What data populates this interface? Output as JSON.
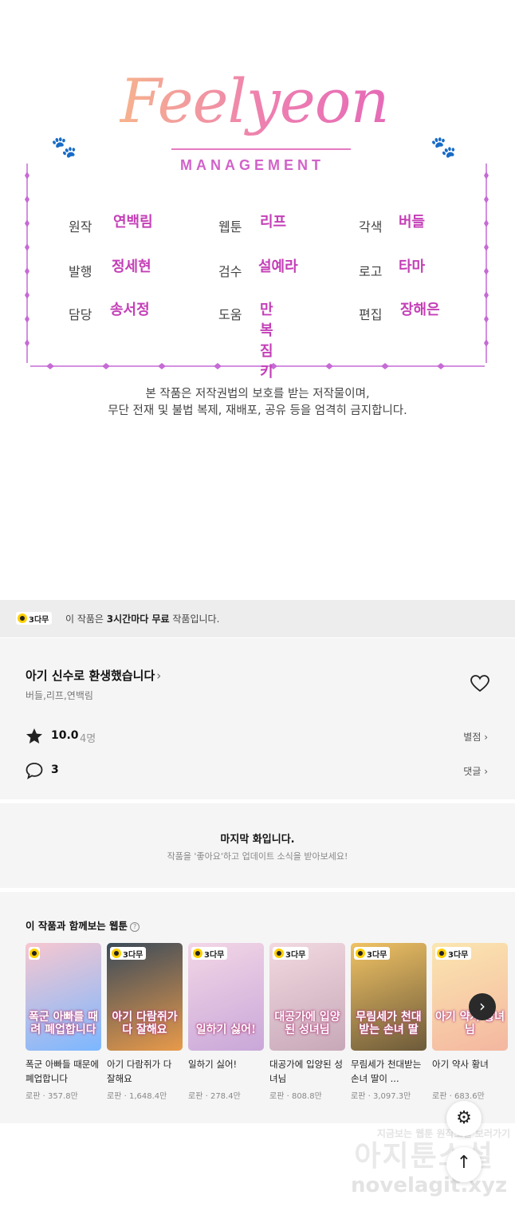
{
  "credits": {
    "logo_script": "Feelyeon",
    "logo_sub": "MANAGEMENT",
    "items": [
      {
        "role": "원작",
        "name": "연백림"
      },
      {
        "role": "웹툰",
        "name": "리프"
      },
      {
        "role": "각색",
        "name": "버들"
      },
      {
        "role": "발행",
        "name": "정세현"
      },
      {
        "role": "검수",
        "name": "설예라"
      },
      {
        "role": "로고",
        "name": "타마"
      },
      {
        "role": "담당",
        "name": "송서정"
      },
      {
        "role": "도움",
        "name": "만복\n짐키"
      },
      {
        "role": "편집",
        "name": "장해은"
      }
    ],
    "copyright_line1": "본 작품은 저작권법의 보호를 받는 저작물이며,",
    "copyright_line2": "무단 전재 및 불법 복제, 재배포, 공유 등을 엄격히 금지합니다."
  },
  "free_bar": {
    "badge": "3다무",
    "text_prefix": "이 작품은 ",
    "text_bold": "3시간마다 무료",
    "text_suffix": " 작품입니다."
  },
  "info": {
    "title": "아기 신수로 환생했습니다",
    "title_chevron": "›",
    "authors": "버들,리프,연백림",
    "rating": "10.0",
    "rating_count": "4명",
    "rating_link": "별점 ›",
    "comment_count": "3",
    "comment_link": "댓글 ›",
    "icons": {
      "heart": "heart-icon",
      "star": "star-icon",
      "comment": "comment-icon"
    }
  },
  "last_episode": {
    "title": "마지막 화입니다.",
    "subtitle": "작품을 '좋아요'하고 업데이트 소식을 받아보세요!"
  },
  "recommendations": {
    "heading": "이 작품과 함께보는 웹툰",
    "help": "?",
    "items": [
      {
        "badge": "",
        "art_title": "폭군 아빠를 때려 폐업합니다",
        "name": "폭군 아빠들 때문에 폐업합니다",
        "genre": "로판",
        "views": "357.8만",
        "colors": [
          "#f7c7d0",
          "#7bb7ff"
        ]
      },
      {
        "badge": "3다무",
        "art_title": "아기 다람쥐가 다 잘해요",
        "name": "아기 다람쥐가 다 잘해요",
        "genre": "로판",
        "views": "1,648.4만",
        "colors": [
          "#3a4a5a",
          "#e89a4a"
        ]
      },
      {
        "badge": "3다무",
        "art_title": "일하기 싫어!",
        "name": "일하기 싫어!",
        "genre": "로판",
        "views": "278.4만",
        "colors": [
          "#f3d6e6",
          "#c9a7d9"
        ]
      },
      {
        "badge": "3다무",
        "art_title": "대공가에 입양된 성녀님",
        "name": "대공가에 입양된 성녀님",
        "genre": "로판",
        "views": "808.8만",
        "colors": [
          "#f2d9e0",
          "#c7a8b8"
        ]
      },
      {
        "badge": "3다무",
        "art_title": "무림세가 천대받는 손녀 딸",
        "name": "무림세가 천대받는 손녀 딸이 ...",
        "genre": "로판",
        "views": "3,097.3만",
        "colors": [
          "#f0c264",
          "#6c5a3a"
        ]
      },
      {
        "badge": "3다무",
        "art_title": "아기 약사 황녀님",
        "name": "아기 약사 황녀",
        "genre": "로판",
        "views": "683.6만",
        "colors": [
          "#fbe6b0",
          "#f4b7a0"
        ]
      }
    ],
    "next": "›"
  },
  "floating": {
    "settings": "⚙",
    "to_top": "↑"
  },
  "watermark": {
    "line1": "지금보는 웹툰 원작소설 보러가기",
    "line2": "아지툰소설",
    "line3": "novelagit.xyz"
  }
}
